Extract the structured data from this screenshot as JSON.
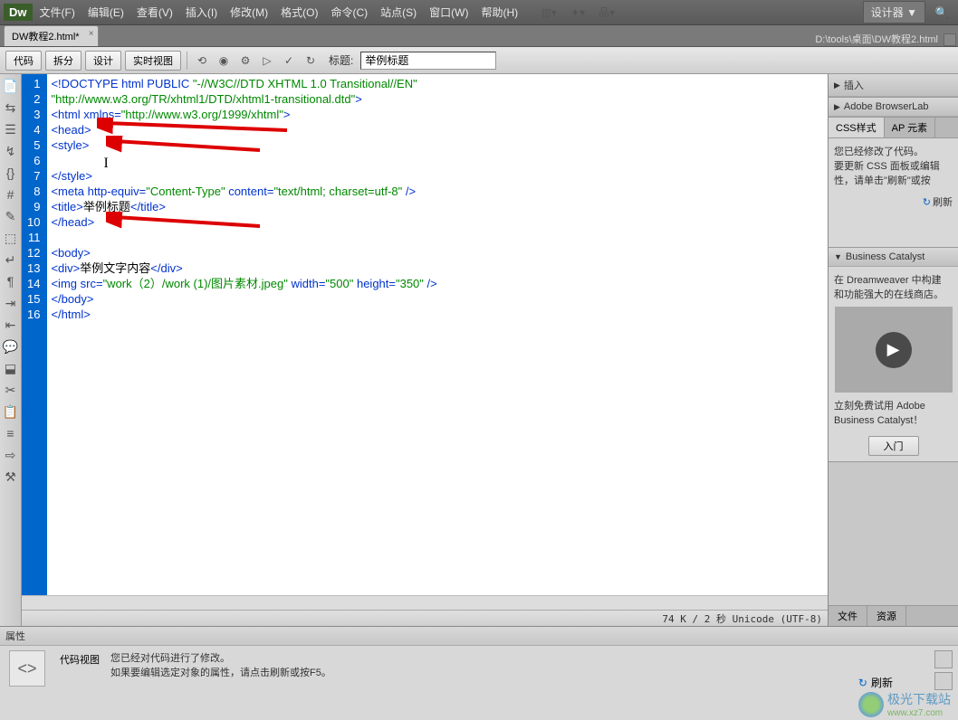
{
  "app": {
    "logo": "Dw"
  },
  "menu": {
    "items": [
      "文件(F)",
      "编辑(E)",
      "查看(V)",
      "插入(I)",
      "修改(M)",
      "格式(O)",
      "命令(C)",
      "站点(S)",
      "窗口(W)",
      "帮助(H)"
    ],
    "designer": "设计器 ▼"
  },
  "tabs": {
    "active": "DW教程2.html*",
    "path": "D:\\tools\\桌面\\DW教程2.html"
  },
  "toolbar": {
    "code": "代码",
    "split": "拆分",
    "design": "设计",
    "live": "实时视图",
    "title_label": "标题:",
    "title_value": "举例标题"
  },
  "code": {
    "lines": [
      "<!DOCTYPE html PUBLIC \"-//W3C//DTD XHTML 1.0 Transitional//EN\"",
      "\"http://www.w3.org/TR/xhtml1/DTD/xhtml1-transitional.dtd\">",
      "<html xmlns=\"http://www.w3.org/1999/xhtml\">",
      "<head>",
      "<style>",
      "",
      "</style>",
      "<meta http-equiv=\"Content-Type\" content=\"text/html; charset=utf-8\" />",
      "<title>举例标题</title>",
      "</head>",
      "",
      "<body>",
      "<div>举例文字内容</div>",
      "<img src=\"work（2）/work (1)/图片素材.jpeg\" width=\"500\" height=\"350\" />",
      "</body>",
      "</html>"
    ],
    "line_count": 16
  },
  "status": "74 K / 2 秒 Unicode (UTF-8)",
  "right": {
    "insert": "插入",
    "browserlab": "Adobe BrowserLab",
    "css_tab": "CSS样式",
    "ap_tab": "AP 元素",
    "css_msg1": "您已经修改了代码。",
    "css_msg2": "要更新 CSS 面板或编辑",
    "css_msg3": "性，请单击\"刷新\"或按",
    "refresh": "刷新",
    "bc_title": "Business Catalyst",
    "bc_msg1": "在 Dreamweaver 中构建",
    "bc_msg2": "和功能强大的在线商店。",
    "bc_try": "立刻免费试用 Adobe Business Catalyst！",
    "bc_btn": "入门",
    "bottom_files": "文件",
    "bottom_assets": "资源"
  },
  "props": {
    "title": "属性",
    "mode": "代码视图",
    "msg1": "您已经对代码进行了修改。",
    "msg2": "如果要编辑选定对象的属性，请点击刷新或按F5。",
    "refresh": "刷新"
  },
  "watermark": {
    "name": "极光下载站",
    "url": "www.xz7.com"
  }
}
